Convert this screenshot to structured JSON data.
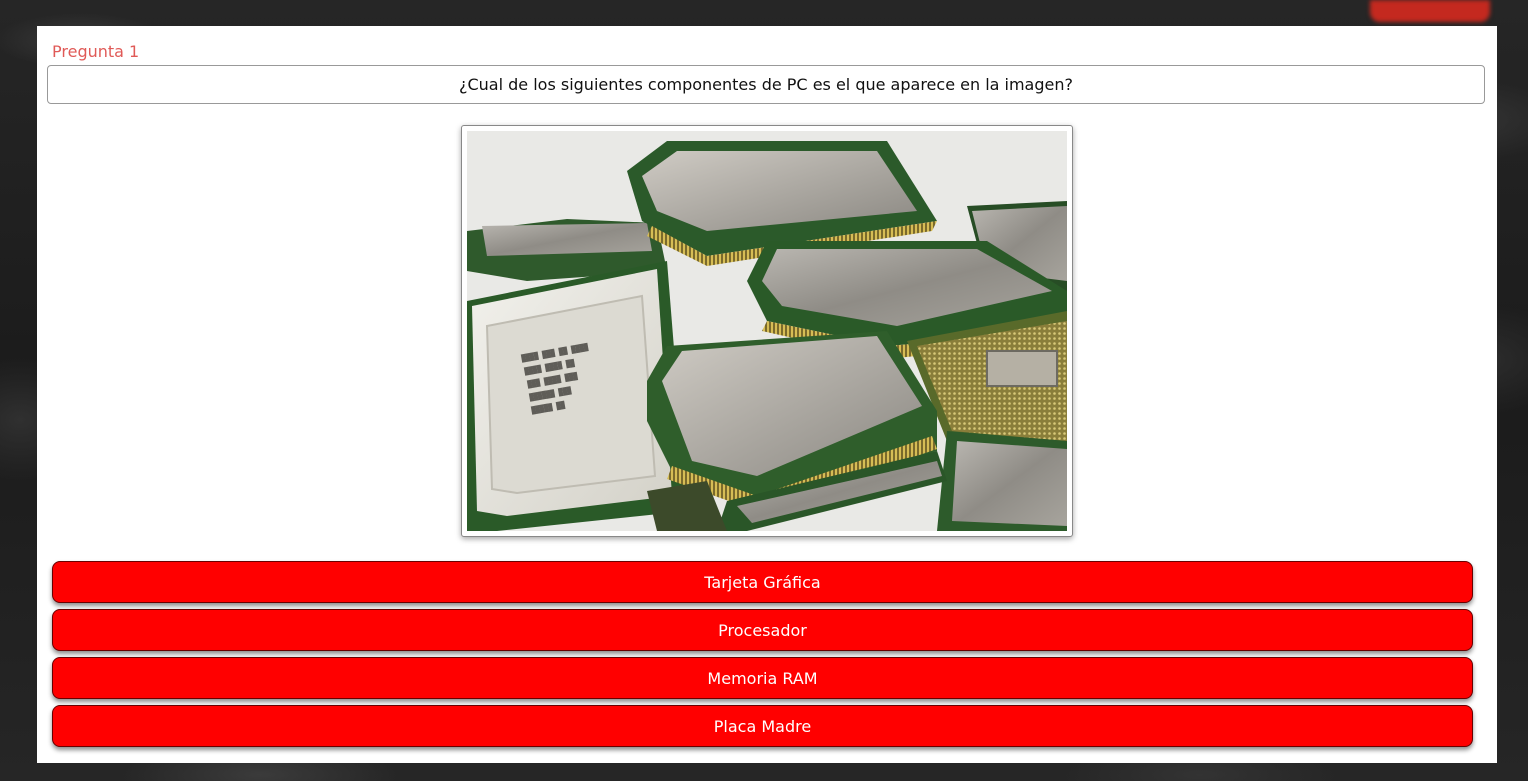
{
  "quiz": {
    "question_number": "Pregunta 1",
    "question_text": "¿Cual de los siguientes componentes de PC es el que aparece en la imagen?",
    "image_subject": "pile of CPU processors",
    "answers": [
      {
        "label": "Tarjeta Gráfica"
      },
      {
        "label": "Procesador"
      },
      {
        "label": "Memoria RAM"
      },
      {
        "label": "Placa Madre"
      }
    ]
  },
  "colors": {
    "answer_button_bg": "#ff0000",
    "answer_button_text": "#ffffff",
    "question_number": "#e05a57",
    "page_background": "#1f1f1f",
    "card_background": "#ffffff"
  }
}
